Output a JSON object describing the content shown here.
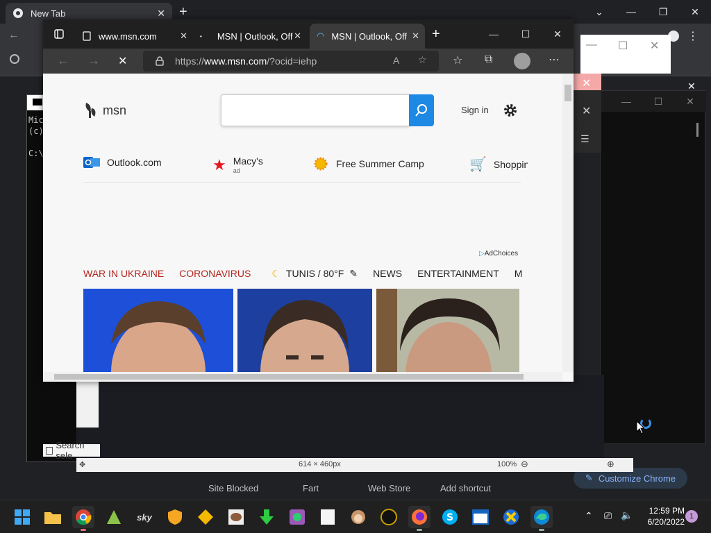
{
  "chrome": {
    "tab_title": "New Tab",
    "shortcuts": [
      "Site Blocked",
      "Fart",
      "Web Store",
      "Add shortcut"
    ],
    "customize_label": "Customize Chrome",
    "status_dims": "614 × 460px",
    "status_zoom": "100%",
    "search_selection": "Search sele"
  },
  "cmd": {
    "lines": "Mic\n(c)\n\nC:\\"
  },
  "edge": {
    "tabs": [
      {
        "label": "www.msn.com"
      },
      {
        "label": "MSN | Outlook, Off"
      },
      {
        "label": "MSN | Outlook, Off"
      }
    ],
    "url_prefix": "https://",
    "url_host": "www.msn.com",
    "url_path": "/?ocid=iehp"
  },
  "msn": {
    "logo": "msn",
    "search_value": "",
    "sign_in": "Sign in",
    "quick_links": [
      {
        "label": "Outlook.com",
        "sub": ""
      },
      {
        "label": "Macy's",
        "sub": "ad"
      },
      {
        "label": "Free Summer Camp",
        "sub": ""
      },
      {
        "label": "Shoppin",
        "sub": ""
      }
    ],
    "ad_choices": "AdChoices",
    "nav": {
      "war": "WAR IN UKRAINE",
      "corona": "CORONAVIRUS",
      "weather": "TUNIS / 80°F",
      "news": "NEWS",
      "entertainment": "ENTERTAINMENT",
      "more": "M"
    }
  },
  "taskbar": {
    "time": "12:59 PM",
    "date": "6/20/2022",
    "notifications": "1"
  },
  "colors": {
    "msn_blue": "#1e88e5",
    "nav_red": "#b3261e"
  }
}
